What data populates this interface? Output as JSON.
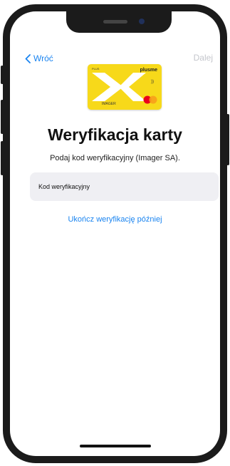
{
  "nav": {
    "back_label": "Wróć",
    "next_label": "Dalej"
  },
  "card": {
    "brand": "plusme",
    "bank": "PLUS",
    "holder": "IMAGER",
    "nfc": "))",
    "network_colors": {
      "left": "#eb001b",
      "right": "#f79e1b"
    },
    "color": "#f7d91a"
  },
  "main": {
    "title": "Weryfikacja karty",
    "subtitle": "Podaj kod weryfikacyjny (Imager SA).",
    "code_field_label": "Kod weryfikacyjny",
    "finish_later": "Ukończ weryfikację później"
  },
  "colors": {
    "accent": "#1a84f0",
    "disabled": "#c4c6cc",
    "field_bg": "#efeff3"
  }
}
